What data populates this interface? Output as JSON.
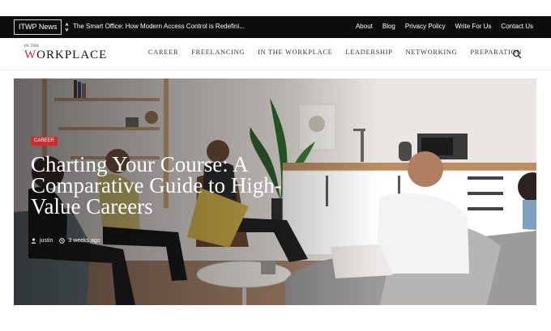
{
  "ticker": {
    "tag": "ITWP News",
    "headline": "The Smart Office: How Modern Access Control is Redefini..."
  },
  "top_links": [
    "About",
    "Blog",
    "Privacy Policy",
    "Write For Us",
    "Contact Us"
  ],
  "logo": {
    "small_text": "In the",
    "main_text": "WORKPLACE",
    "accent": "#c82b34"
  },
  "menu": [
    "CAREER",
    "FREELANCING",
    "IN THE WORKPLACE",
    "LEADERSHIP",
    "NETWORKING",
    "PREPARATION"
  ],
  "featured": {
    "category": "CAREER",
    "title": "Charting Your Course: A Comparative Guide to High-Value Careers",
    "author": "justin",
    "time_ago": "3 weeks ago"
  },
  "colors": {
    "topbar_bg": "#0d0d0d",
    "badge": "#cf2d2d",
    "text_dark": "#111111"
  },
  "icons": {
    "ticker_control": "scroll-arrows-icon",
    "search": "search-icon",
    "author": "user-icon",
    "time": "clock-icon"
  }
}
